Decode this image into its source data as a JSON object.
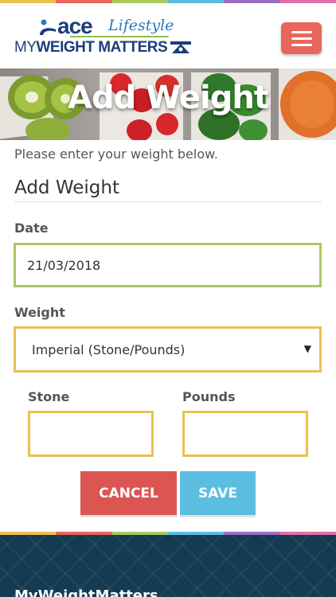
{
  "brand": {
    "ace": "ace",
    "lifestyle": "Lifestyle",
    "line2_light": "MY",
    "line2_bold": "WEIGHT MATTERS"
  },
  "menu": {
    "icon": "hamburger-icon"
  },
  "banner": {
    "title": "Add Weight"
  },
  "intro": "Please enter your weight below.",
  "form": {
    "title": "Add Weight",
    "date_label": "Date",
    "date_value": "21/03/2018",
    "weight_label": "Weight",
    "weight_unit_selected": "Imperial (Stone/Pounds)",
    "stone_label": "Stone",
    "stone_value": "",
    "pounds_label": "Pounds",
    "pounds_value": ""
  },
  "buttons": {
    "cancel": "CANCEL",
    "save": "SAVE"
  },
  "footer": {
    "title": "MyWeightMatters"
  },
  "colors": {
    "menu_button": "#e8665b",
    "date_border": "#a9c95f",
    "weight_border": "#e9c14f",
    "cancel": "#db5553",
    "save": "#5bbde0",
    "footer_bg": "#143b52",
    "stripe": [
      "#e9c14f",
      "#e8665b",
      "#a9c95f",
      "#5bbde0",
      "#9b6fc1",
      "#e36fa8"
    ]
  }
}
